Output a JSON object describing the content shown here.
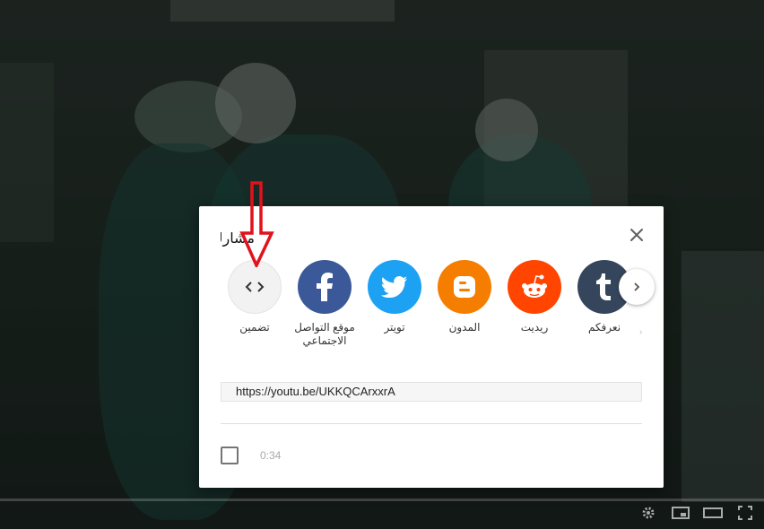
{
  "dialog": {
    "title": "مشارك",
    "close_label": "×"
  },
  "share_items": [
    {
      "label": "تضمين",
      "icon": "embed-icon",
      "color": "#f2f2f2"
    },
    {
      "label": "موقع التواصل الاجتماعي",
      "icon": "facebook-icon",
      "color": "#3b5998"
    },
    {
      "label": "تويتر",
      "icon": "twitter-icon",
      "color": "#1da1f2"
    },
    {
      "label": "المدون",
      "icon": "blogger-icon",
      "color": "#f57d00"
    },
    {
      "label": "ريديت",
      "icon": "reddit-icon",
      "color": "#ff4500"
    },
    {
      "label": "نعرفكم",
      "icon": "tumblr-icon",
      "color": "#35465c"
    }
  ],
  "link": {
    "url": "https://youtu.be/UKKQCArxxrA"
  },
  "start_at": {
    "time": "0:34"
  },
  "annotation": {
    "arrow_color": "#e0121c"
  }
}
